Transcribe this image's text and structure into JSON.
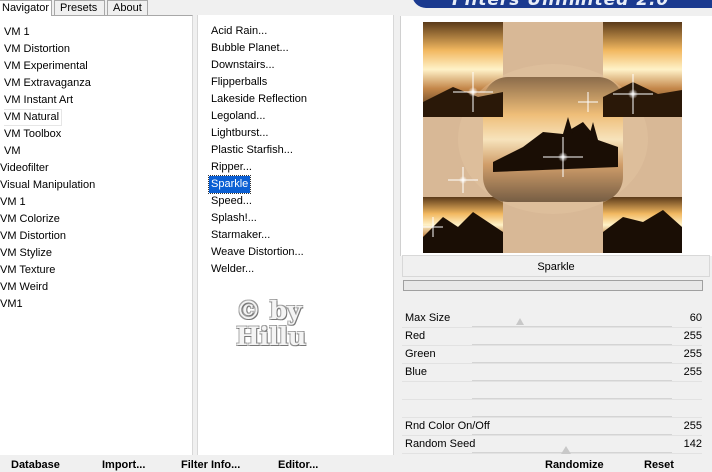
{
  "tabs": [
    {
      "label": "Navigator",
      "active": true
    },
    {
      "label": "Presets",
      "active": false
    },
    {
      "label": "About",
      "active": false
    }
  ],
  "categories": [
    "VM 1",
    "VM Distortion",
    "VM Experimental",
    "VM Extravaganza",
    "VM Instant Art",
    "VM Natural",
    "VM Toolbox",
    "VM",
    "Videofilter",
    "Visual Manipulation",
    "VM 1",
    "VM Colorize",
    "VM Distortion",
    "VM Stylize",
    "VM Texture",
    "VM Weird",
    "VM1"
  ],
  "filters": [
    "Acid Rain...",
    "Bubble Planet...",
    "Downstairs...",
    "Flipperballs",
    "Lakeside Reflection",
    "Legoland...",
    "Lightburst...",
    "Plastic Starfish...",
    "Ripper...",
    "Sparkle",
    "Speed...",
    "Splash!...",
    "Starmaker...",
    "Weave Distortion...",
    "Welder..."
  ],
  "selected_filter_index": 9,
  "watermark_text": [
    "© by",
    "Hillu"
  ],
  "filter_title": "Sparkle",
  "params": [
    {
      "name": "Max Size",
      "value": "60",
      "level": 0.24
    },
    {
      "name": "Red",
      "value": "255",
      "level": 1.0
    },
    {
      "name": "Green",
      "value": "255",
      "level": 1.0
    },
    {
      "name": "Blue",
      "value": "255",
      "level": 1.0
    },
    {
      "name": "",
      "value": "",
      "level": null
    },
    {
      "name": "",
      "value": "",
      "level": null
    },
    {
      "name": "Rnd Color On/Off",
      "value": "255",
      "level": 1.0
    },
    {
      "name": "Random Seed",
      "value": "142",
      "level": 0.56
    }
  ],
  "bottom_buttons": {
    "database": "Database",
    "import": "Import...",
    "filter_info": "Filter Info...",
    "editor": "Editor...",
    "randomize": "Randomize",
    "reset": "Reset"
  },
  "colors": {
    "selection": "#0a5fd4",
    "brand_banner": "#1b3a8f"
  }
}
